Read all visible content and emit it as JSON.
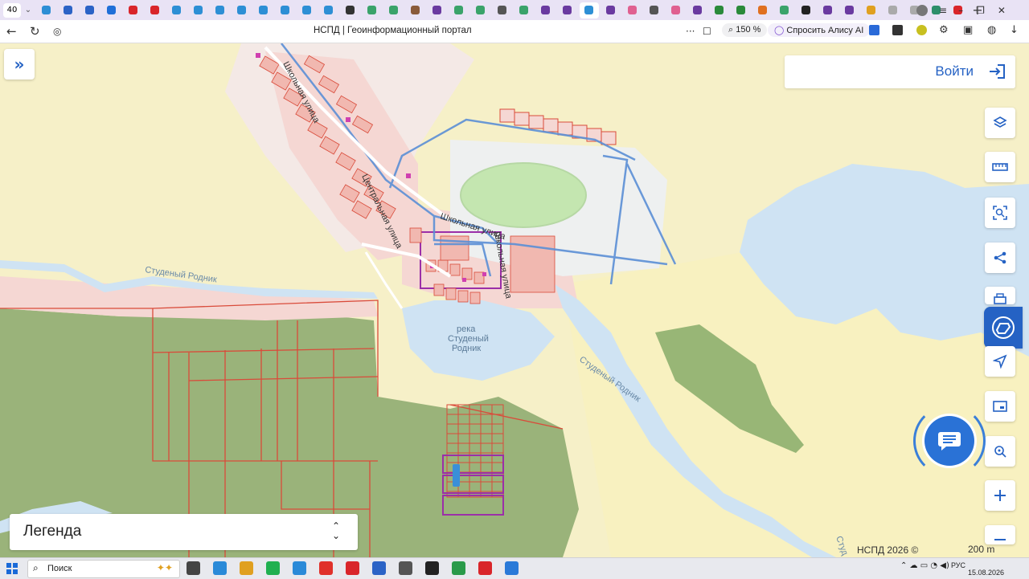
{
  "browser": {
    "tab_count_badge": "40",
    "active_tab_index": 25,
    "tab_icons": [
      "#2d8fd5",
      "#2b63c6",
      "#2b63c6",
      "#1f6fd8",
      "#d9252a",
      "#d9252a",
      "#2d8fd5",
      "#2d8fd5",
      "#2d8fd5",
      "#2d8fd5",
      "#2d8fd5",
      "#2d8fd5",
      "#2d8fd5",
      "#2d8fd5",
      "#333333",
      "#3aa36a",
      "#3aa36a",
      "#8a5a3a",
      "#6a3aa0",
      "#3aa36a",
      "#3aa36a",
      "#555555",
      "#3aa36a",
      "#6a3aa0",
      "#6a3aa0",
      "#2d8fd5",
      "#6a3aa0",
      "#e06090",
      "#555555",
      "#e06090",
      "#6a3aa0",
      "#2a8a3a",
      "#2a8a3a",
      "#e07020",
      "#3aa36a",
      "#222222",
      "#6a3aa0",
      "#6a3aa0",
      "#e0a020",
      "#aaaaaa",
      "#aaaaaa",
      "#2d8f6a",
      "#d9252a"
    ],
    "page_title": "НСПД | Геоинформационный портал",
    "zoom": "150 %",
    "alice_label": "Спросить Алису AI"
  },
  "map": {
    "street_labels": [
      "Школьная улица",
      "Центральная улица",
      "Школьная улица",
      "Школьная улица"
    ],
    "river_label_1": "Студеный Родник",
    "lake_label_line1": "река",
    "lake_label_line2": "Студеный",
    "lake_label_line3": "Родник",
    "river_label_2": "Студеный Родник",
    "river_label_3": "Студ",
    "colors": {
      "field": "#f6f0c8",
      "forest": "#9ab37a",
      "water": "#cfe3f3",
      "settlement": "#f5d7d3",
      "parcel_line": "#d94b3a",
      "stadium": "#c4e6b0",
      "network": "#5b8fd6",
      "highlight": "#9b2fa8"
    }
  },
  "controls": {
    "login_label": "Войти",
    "legend_label": "Легенда",
    "copyright": "НСПД 2026 ©",
    "scale": "200 m"
  },
  "taskbar": {
    "search_label": "Поиск",
    "lang": "РУС",
    "date": "15.08.2026",
    "apps": [
      "#444444",
      "#2a8ad8",
      "#e0a020",
      "#20b050",
      "#2a8ad8",
      "#e0302a",
      "#d9252a",
      "#2b63c6",
      "#555555",
      "#222222",
      "#2a9a4a",
      "#d9252a",
      "#2a7ad8"
    ]
  }
}
